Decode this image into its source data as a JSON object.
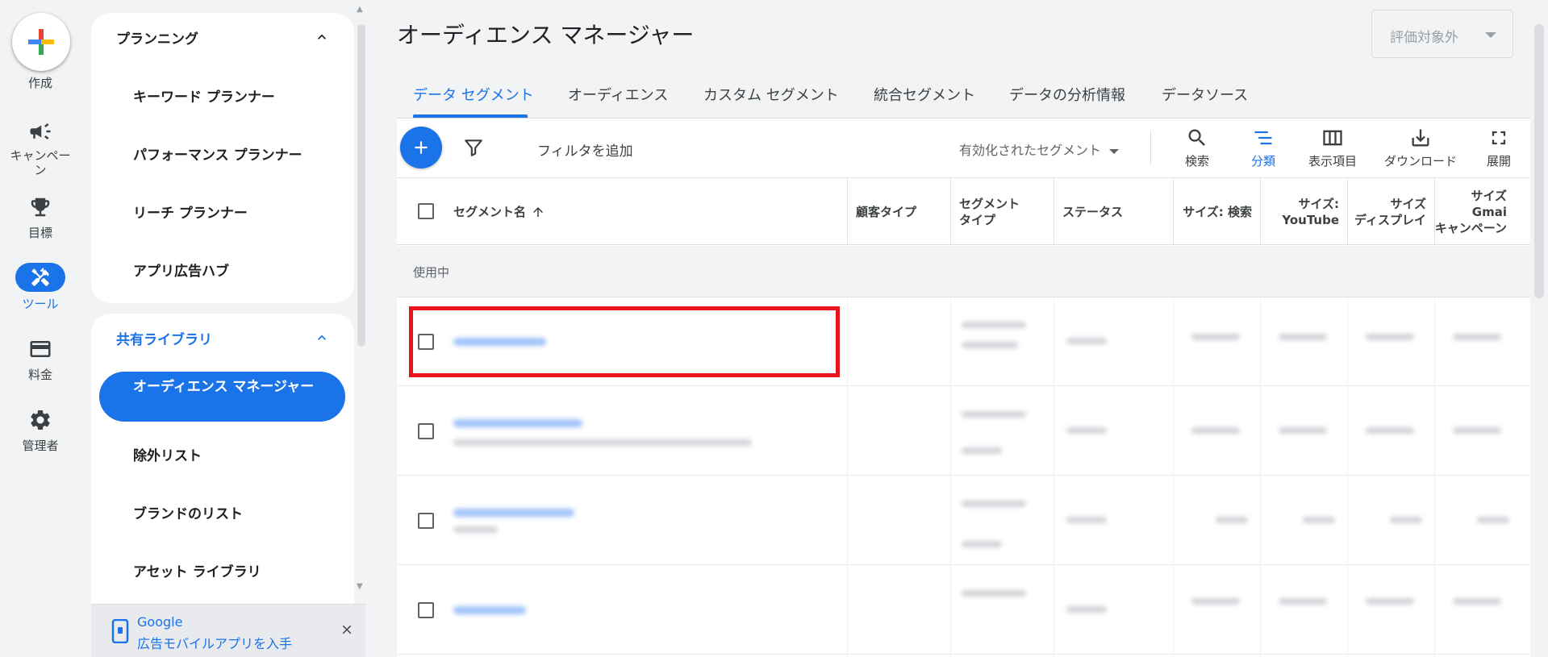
{
  "rail": {
    "create_label": "作成",
    "items": [
      {
        "label": "キャンペーン",
        "icon": "megaphone-icon"
      },
      {
        "label": "目標",
        "icon": "trophy-icon"
      },
      {
        "label": "ツール",
        "icon": "tools-icon"
      },
      {
        "label": "料金",
        "icon": "credit-card-icon"
      },
      {
        "label": "管理者",
        "icon": "gear-icon"
      }
    ]
  },
  "sidenav": {
    "planning": {
      "heading": "プランニング",
      "items": [
        "キーワード プランナー",
        "パフォーマンス プランナー",
        "リーチ プランナー",
        "アプリ広告ハブ"
      ]
    },
    "shared_library": {
      "heading": "共有ライブラリ",
      "active_item": "オーディエンス マネージャー",
      "items": [
        "除外リスト",
        "ブランドのリスト",
        "アセット ライブラリ"
      ]
    },
    "promo": {
      "line1": "Google",
      "line2": "広告モバイルアプリを入手"
    }
  },
  "header": {
    "title": "オーディエンス マネージャー",
    "scope_select": "評価対象外"
  },
  "tabs": [
    "データ セグメント",
    "オーディエンス",
    "カスタム セグメント",
    "統合セグメント",
    "データの分析情報",
    "データソース"
  ],
  "toolbar": {
    "filter_label": "フィルタを追加",
    "segment_filter": "有効化されたセグメント",
    "buttons": [
      {
        "label": "検索",
        "icon": "search-icon"
      },
      {
        "label": "分類",
        "icon": "segment-icon"
      },
      {
        "label": "表示項目",
        "icon": "columns-icon"
      },
      {
        "label": "ダウンロード",
        "icon": "download-icon"
      },
      {
        "label": "展開",
        "icon": "fullscreen-icon"
      }
    ]
  },
  "table": {
    "columns": {
      "name": "セグメント名",
      "customer_type": "顧客タイプ",
      "segment_type_1": "セグメント",
      "segment_type_2": "タイプ",
      "status": "ステータス",
      "size_search": "サイズ: 検索",
      "size_youtube_1": "サイズ:",
      "size_youtube_2": "YouTube",
      "size_display_1": "サイズ",
      "size_display_2": "ディスプレイ",
      "size_gmail_1": "サイズ",
      "size_gmail_2": "Gmai",
      "size_gmail_3": "キャンペーン"
    },
    "group_label": "使用中"
  },
  "colors": {
    "accent": "#1a73e8",
    "highlight": "#e8141b"
  }
}
